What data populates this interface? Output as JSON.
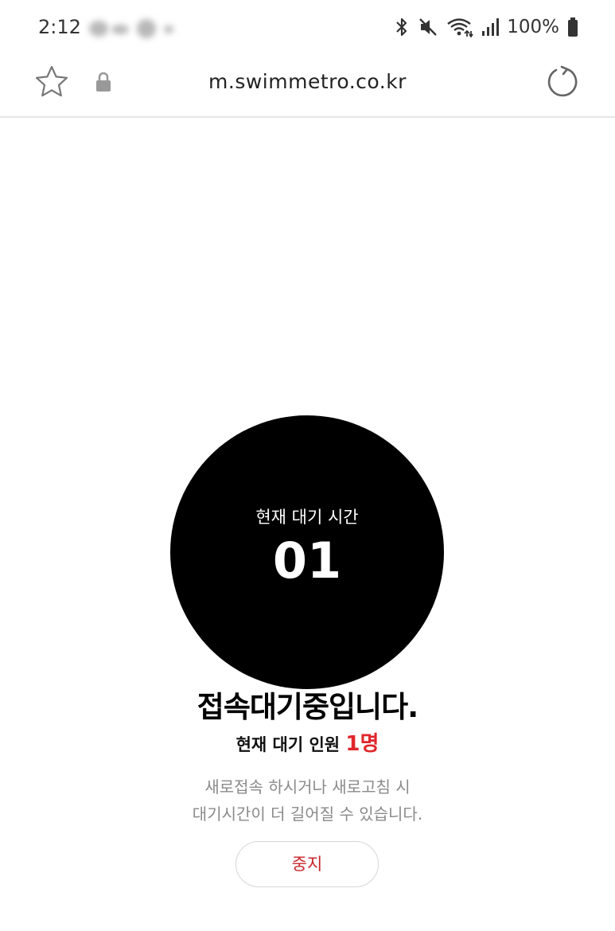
{
  "status_bar": {
    "time": "2:12",
    "battery_text": "100%",
    "icons": [
      "bluetooth-icon",
      "mute-icon",
      "wifi-icon",
      "signal-icon",
      "battery-icon"
    ]
  },
  "browser": {
    "url": "m.swimmetro.co.kr",
    "icons": [
      "star-icon",
      "lock-icon",
      "reload-icon"
    ]
  },
  "queue": {
    "circle_label": "현재 대기 시간",
    "circle_value": "01",
    "heading": "접속대기중입니다.",
    "count_label": "현재 대기 인원",
    "count_value": "1명",
    "notice_line1": "새로접속 하시거나 새로고침 시",
    "notice_line2": "대기시간이 더 길어질 수 있습니다.",
    "stop_label": "중지"
  },
  "colors": {
    "accent_red": "#e0262b",
    "circle": "#000000",
    "muted_text": "#8a8a8a"
  }
}
